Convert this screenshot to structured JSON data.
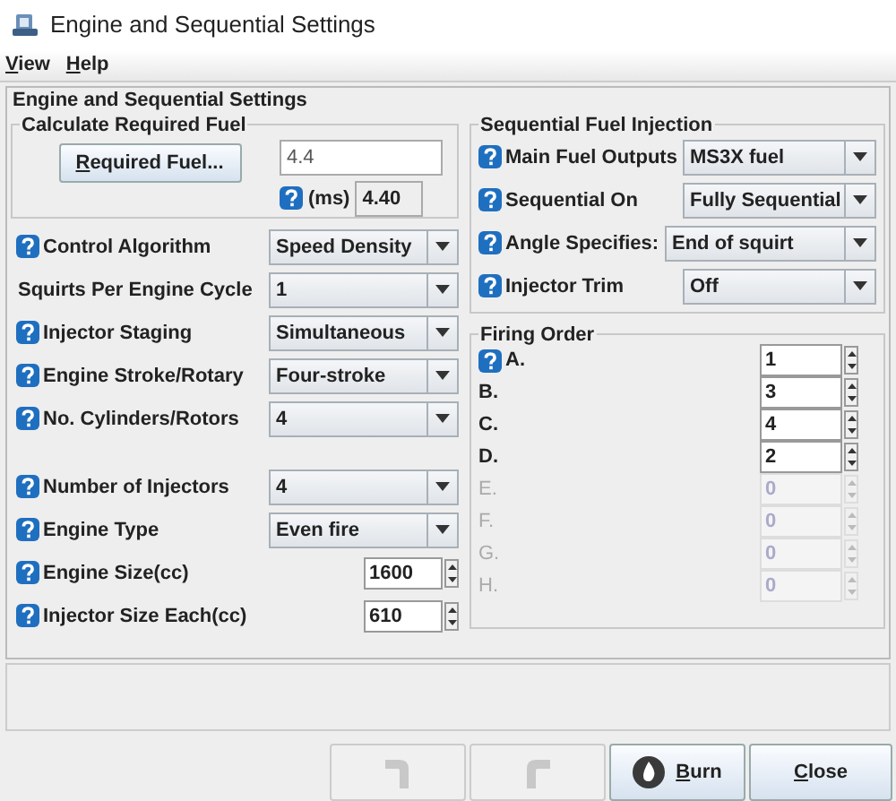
{
  "window": {
    "title": "Engine and Sequential Settings"
  },
  "menu": [
    {
      "label": "View",
      "mnemonic": true
    },
    {
      "label": "Help",
      "mnemonic": true
    }
  ],
  "panel": {
    "title": "Engine and Sequential Settings"
  },
  "required_fuel": {
    "title": "Calculate Required Fuel",
    "button": {
      "label": "Required Fuel...",
      "mnemonic": true
    },
    "value": "4.4",
    "unit": "(ms)",
    "computed": "4.40"
  },
  "settings_top": [
    {
      "kind": "combo",
      "help": true,
      "label": "Control Algorithm",
      "value": "Speed Density"
    },
    {
      "kind": "combo",
      "help": false,
      "label": "Squirts Per Engine Cycle",
      "value": "1"
    },
    {
      "kind": "combo",
      "help": true,
      "label": "Injector Staging",
      "value": "Simultaneous"
    },
    {
      "kind": "combo",
      "help": true,
      "label": "Engine Stroke/Rotary",
      "value": "Four-stroke"
    },
    {
      "kind": "combo",
      "help": true,
      "label": "No. Cylinders/Rotors",
      "value": "4"
    }
  ],
  "settings_bottom": [
    {
      "kind": "combo",
      "help": true,
      "label": "Number of Injectors",
      "value": "4"
    },
    {
      "kind": "combo",
      "help": true,
      "label": "Engine Type",
      "value": "Even fire"
    },
    {
      "kind": "spinner",
      "help": true,
      "label": "Engine Size(cc)",
      "value": "1600"
    },
    {
      "kind": "spinner",
      "help": true,
      "label": "Injector Size Each(cc)",
      "value": "610"
    }
  ],
  "sequential": {
    "title": "Sequential Fuel Injection",
    "rows": [
      {
        "help": true,
        "label": "Main Fuel Outputs",
        "value": "MS3X fuel"
      },
      {
        "help": true,
        "label": "Sequential On",
        "value": "Fully Sequential"
      },
      {
        "help": true,
        "label": "Angle Specifies:",
        "value": "End of squirt"
      },
      {
        "help": true,
        "label": "Injector Trim",
        "value": "Off"
      }
    ]
  },
  "firing_order": {
    "title": "Firing Order",
    "rows": [
      {
        "help": true,
        "label": "A.",
        "value": "1",
        "disabled": false
      },
      {
        "help": false,
        "label": "B.",
        "value": "3",
        "disabled": false
      },
      {
        "help": false,
        "label": "C.",
        "value": "4",
        "disabled": false
      },
      {
        "help": false,
        "label": "D.",
        "value": "2",
        "disabled": false
      },
      {
        "help": false,
        "label": "E.",
        "value": "0",
        "disabled": true
      },
      {
        "help": false,
        "label": "F.",
        "value": "0",
        "disabled": true
      },
      {
        "help": false,
        "label": "G.",
        "value": "0",
        "disabled": true
      },
      {
        "help": false,
        "label": "H.",
        "value": "0",
        "disabled": true
      }
    ]
  },
  "buttons": [
    {
      "kind": "undo",
      "disabled": true
    },
    {
      "kind": "redo",
      "disabled": true
    },
    {
      "kind": "burn",
      "label": "Burn",
      "mnemonic": true,
      "disabled": false
    },
    {
      "kind": "close",
      "label": "Close",
      "mnemonic": true,
      "disabled": false
    }
  ]
}
